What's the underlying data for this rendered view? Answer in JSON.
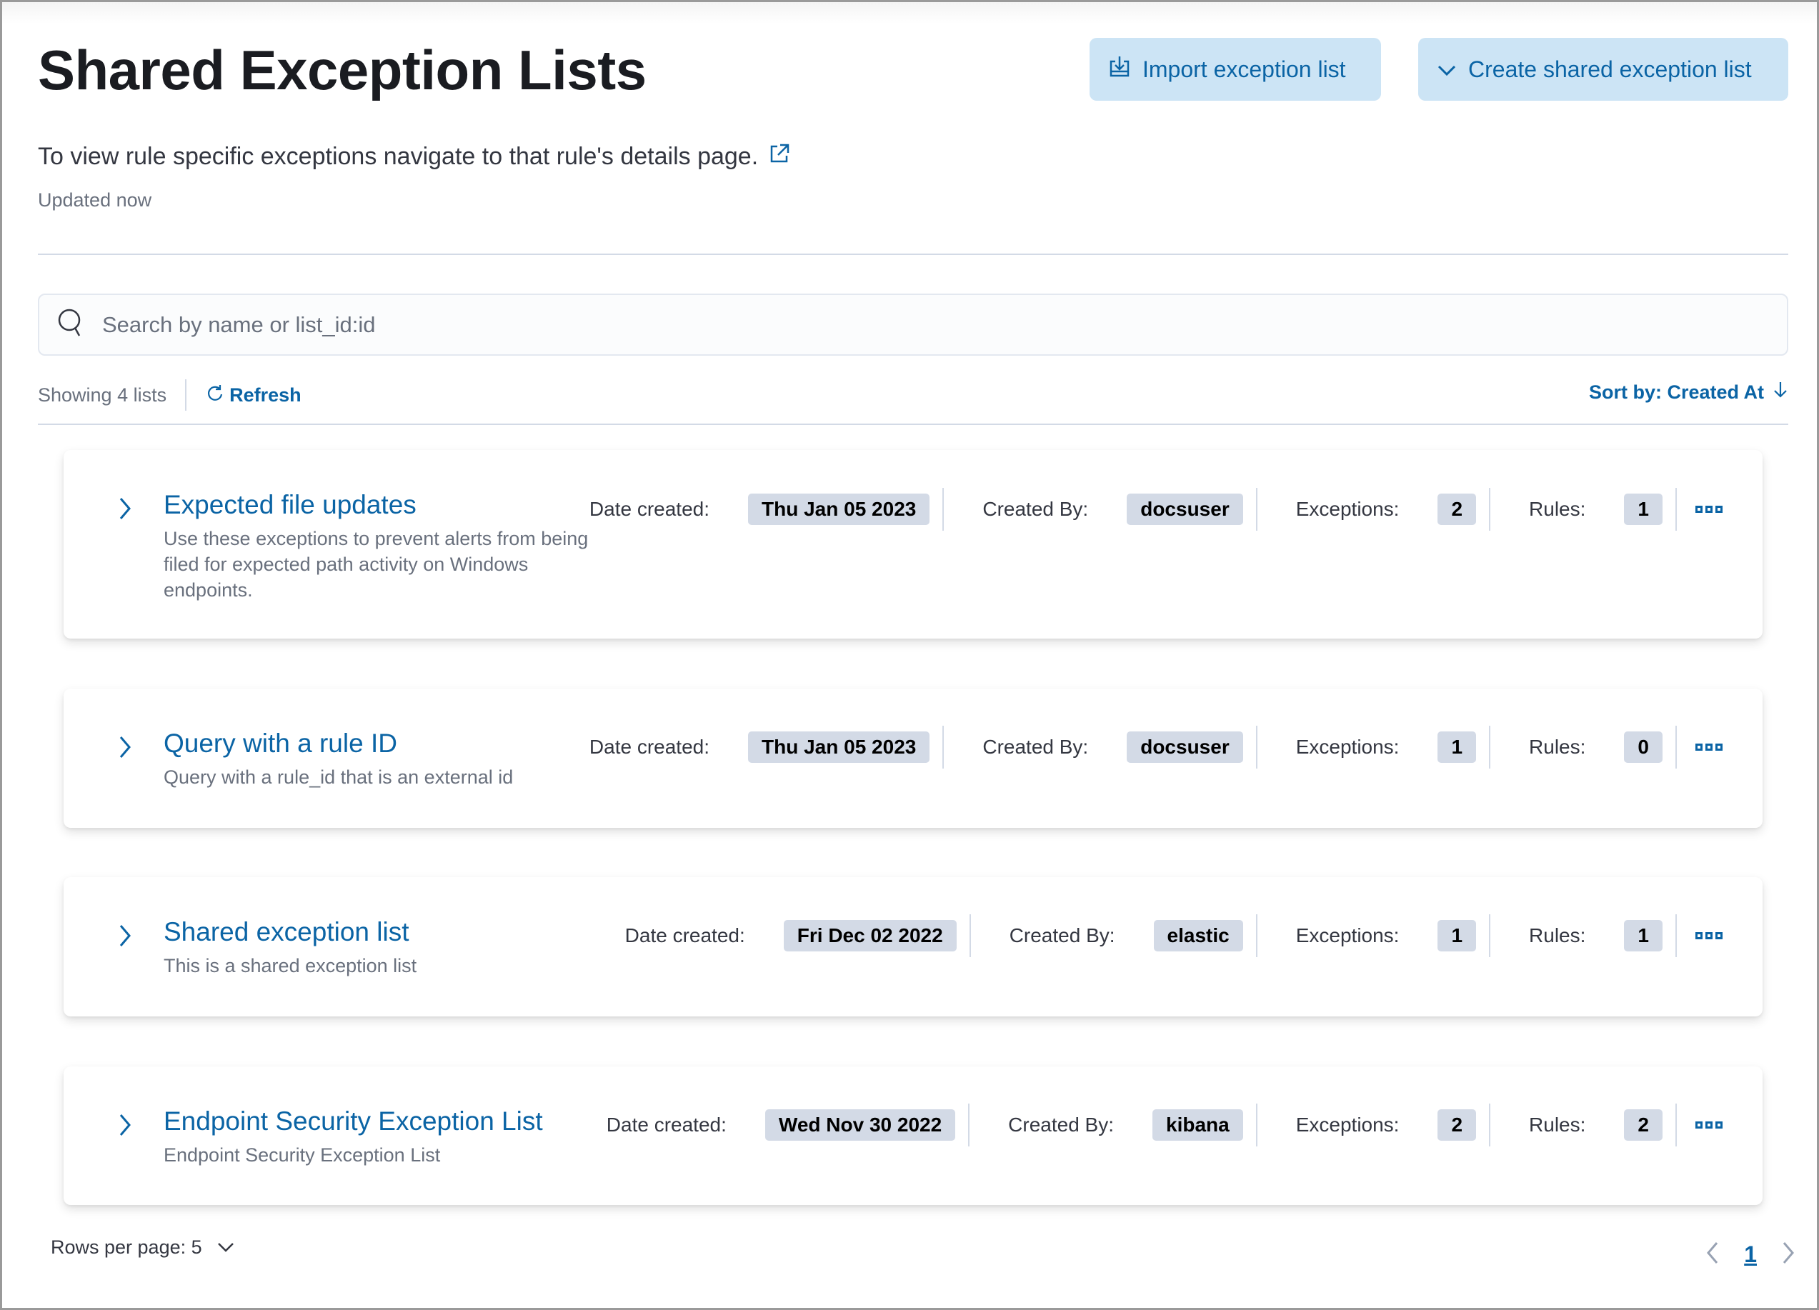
{
  "header": {
    "title": "Shared Exception Lists",
    "import_button": "Import exception list",
    "create_button": "Create shared exception list",
    "description": "To view rule specific exceptions navigate to that rule's details page.",
    "updated": "Updated now"
  },
  "search": {
    "placeholder": "Search by name or list_id:id",
    "value": ""
  },
  "toolbar": {
    "showing": "Showing 4 lists",
    "refresh": "Refresh",
    "sort": "Sort by: Created At"
  },
  "meta_labels": {
    "date_created": "Date created:",
    "created_by": "Created By:",
    "exceptions": "Exceptions:",
    "rules": "Rules:"
  },
  "lists": [
    {
      "name": "Expected file updates",
      "description": "Use these exceptions to prevent alerts from being filed for expected path activity on Windows endpoints.",
      "date_created": "Thu Jan 05 2023",
      "created_by": "docsuser",
      "exceptions": "2",
      "rules": "1"
    },
    {
      "name": "Query with a rule ID",
      "description": "Query with a rule_id that is an external id",
      "date_created": "Thu Jan 05 2023",
      "created_by": "docsuser",
      "exceptions": "1",
      "rules": "0"
    },
    {
      "name": "Shared exception list",
      "description": "This is a shared exception list",
      "date_created": "Fri Dec 02 2022",
      "created_by": "elastic",
      "exceptions": "1",
      "rules": "1"
    },
    {
      "name": "Endpoint Security Exception List",
      "description": "Endpoint Security Exception List",
      "date_created": "Wed Nov 30 2022",
      "created_by": "kibana",
      "exceptions": "2",
      "rules": "2"
    }
  ],
  "pagination": {
    "rows_per_page": "Rows per page: 5",
    "current_page": "1"
  },
  "colors": {
    "accent": "#0b64a5",
    "button_bg": "#cce4f5",
    "badge_bg": "#d3dae6"
  }
}
